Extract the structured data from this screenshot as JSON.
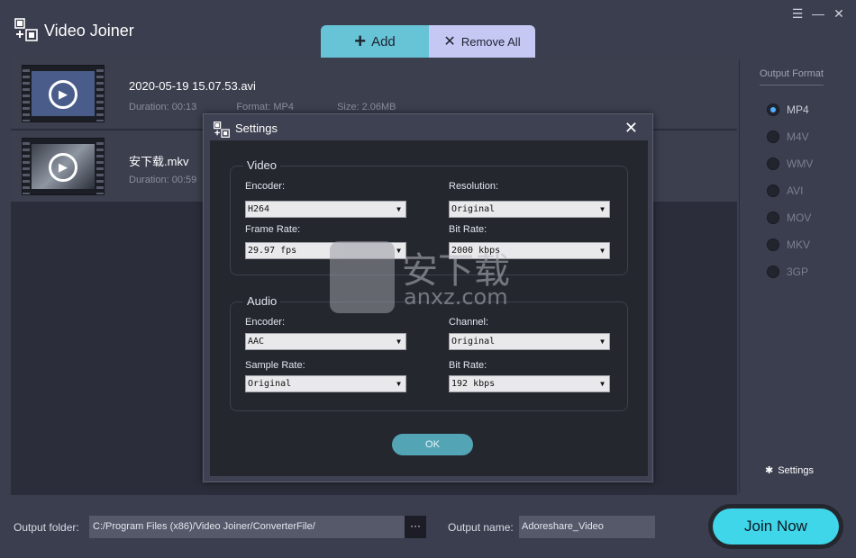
{
  "app": {
    "title": "Video Joiner",
    "window_controls": [
      "menu-icon",
      "minimize-icon",
      "close-icon"
    ]
  },
  "toolbar": {
    "add_label": "Add",
    "remove_all_label": "Remove All"
  },
  "files": [
    {
      "name": "2020-05-19 15.07.53.avi",
      "duration_label": "Duration:",
      "duration": "00:13",
      "format_label": "Format:",
      "format": "MP4",
      "size_label": "Size:",
      "size": "2.06MB"
    },
    {
      "name": "安下载.mkv",
      "duration_label": "Duration:",
      "duration": "00:59"
    }
  ],
  "output_format": {
    "title": "Output Format",
    "options": [
      "MP4",
      "M4V",
      "WMV",
      "AVI",
      "MOV",
      "MKV",
      "3GP"
    ],
    "selected": "MP4",
    "settings_label": "Settings"
  },
  "bottom": {
    "folder_label": "Output folder:",
    "folder_value": "C:/Program Files (x86)/Video Joiner/ConverterFile/",
    "browse_label": "···",
    "name_label": "Output name:",
    "name_value": "Adoreshare_Video",
    "join_label": "Join Now"
  },
  "settings_dialog": {
    "title": "Settings",
    "video": {
      "legend": "Video",
      "encoder_label": "Encoder:",
      "encoder": "H264",
      "resolution_label": "Resolution:",
      "resolution": "Original",
      "frame_rate_label": "Frame Rate:",
      "frame_rate": "29.97 fps",
      "bit_rate_label": "Bit Rate:",
      "bit_rate": "2000 kbps"
    },
    "audio": {
      "legend": "Audio",
      "encoder_label": "Encoder:",
      "encoder": "AAC",
      "channel_label": "Channel:",
      "channel": "Original",
      "sample_rate_label": "Sample Rate:",
      "sample_rate": "Original",
      "bit_rate_label": "Bit Rate:",
      "bit_rate": "192 kbps"
    },
    "ok_label": "OK"
  },
  "watermark": {
    "text": "安下载",
    "sub": "anxz.com"
  }
}
